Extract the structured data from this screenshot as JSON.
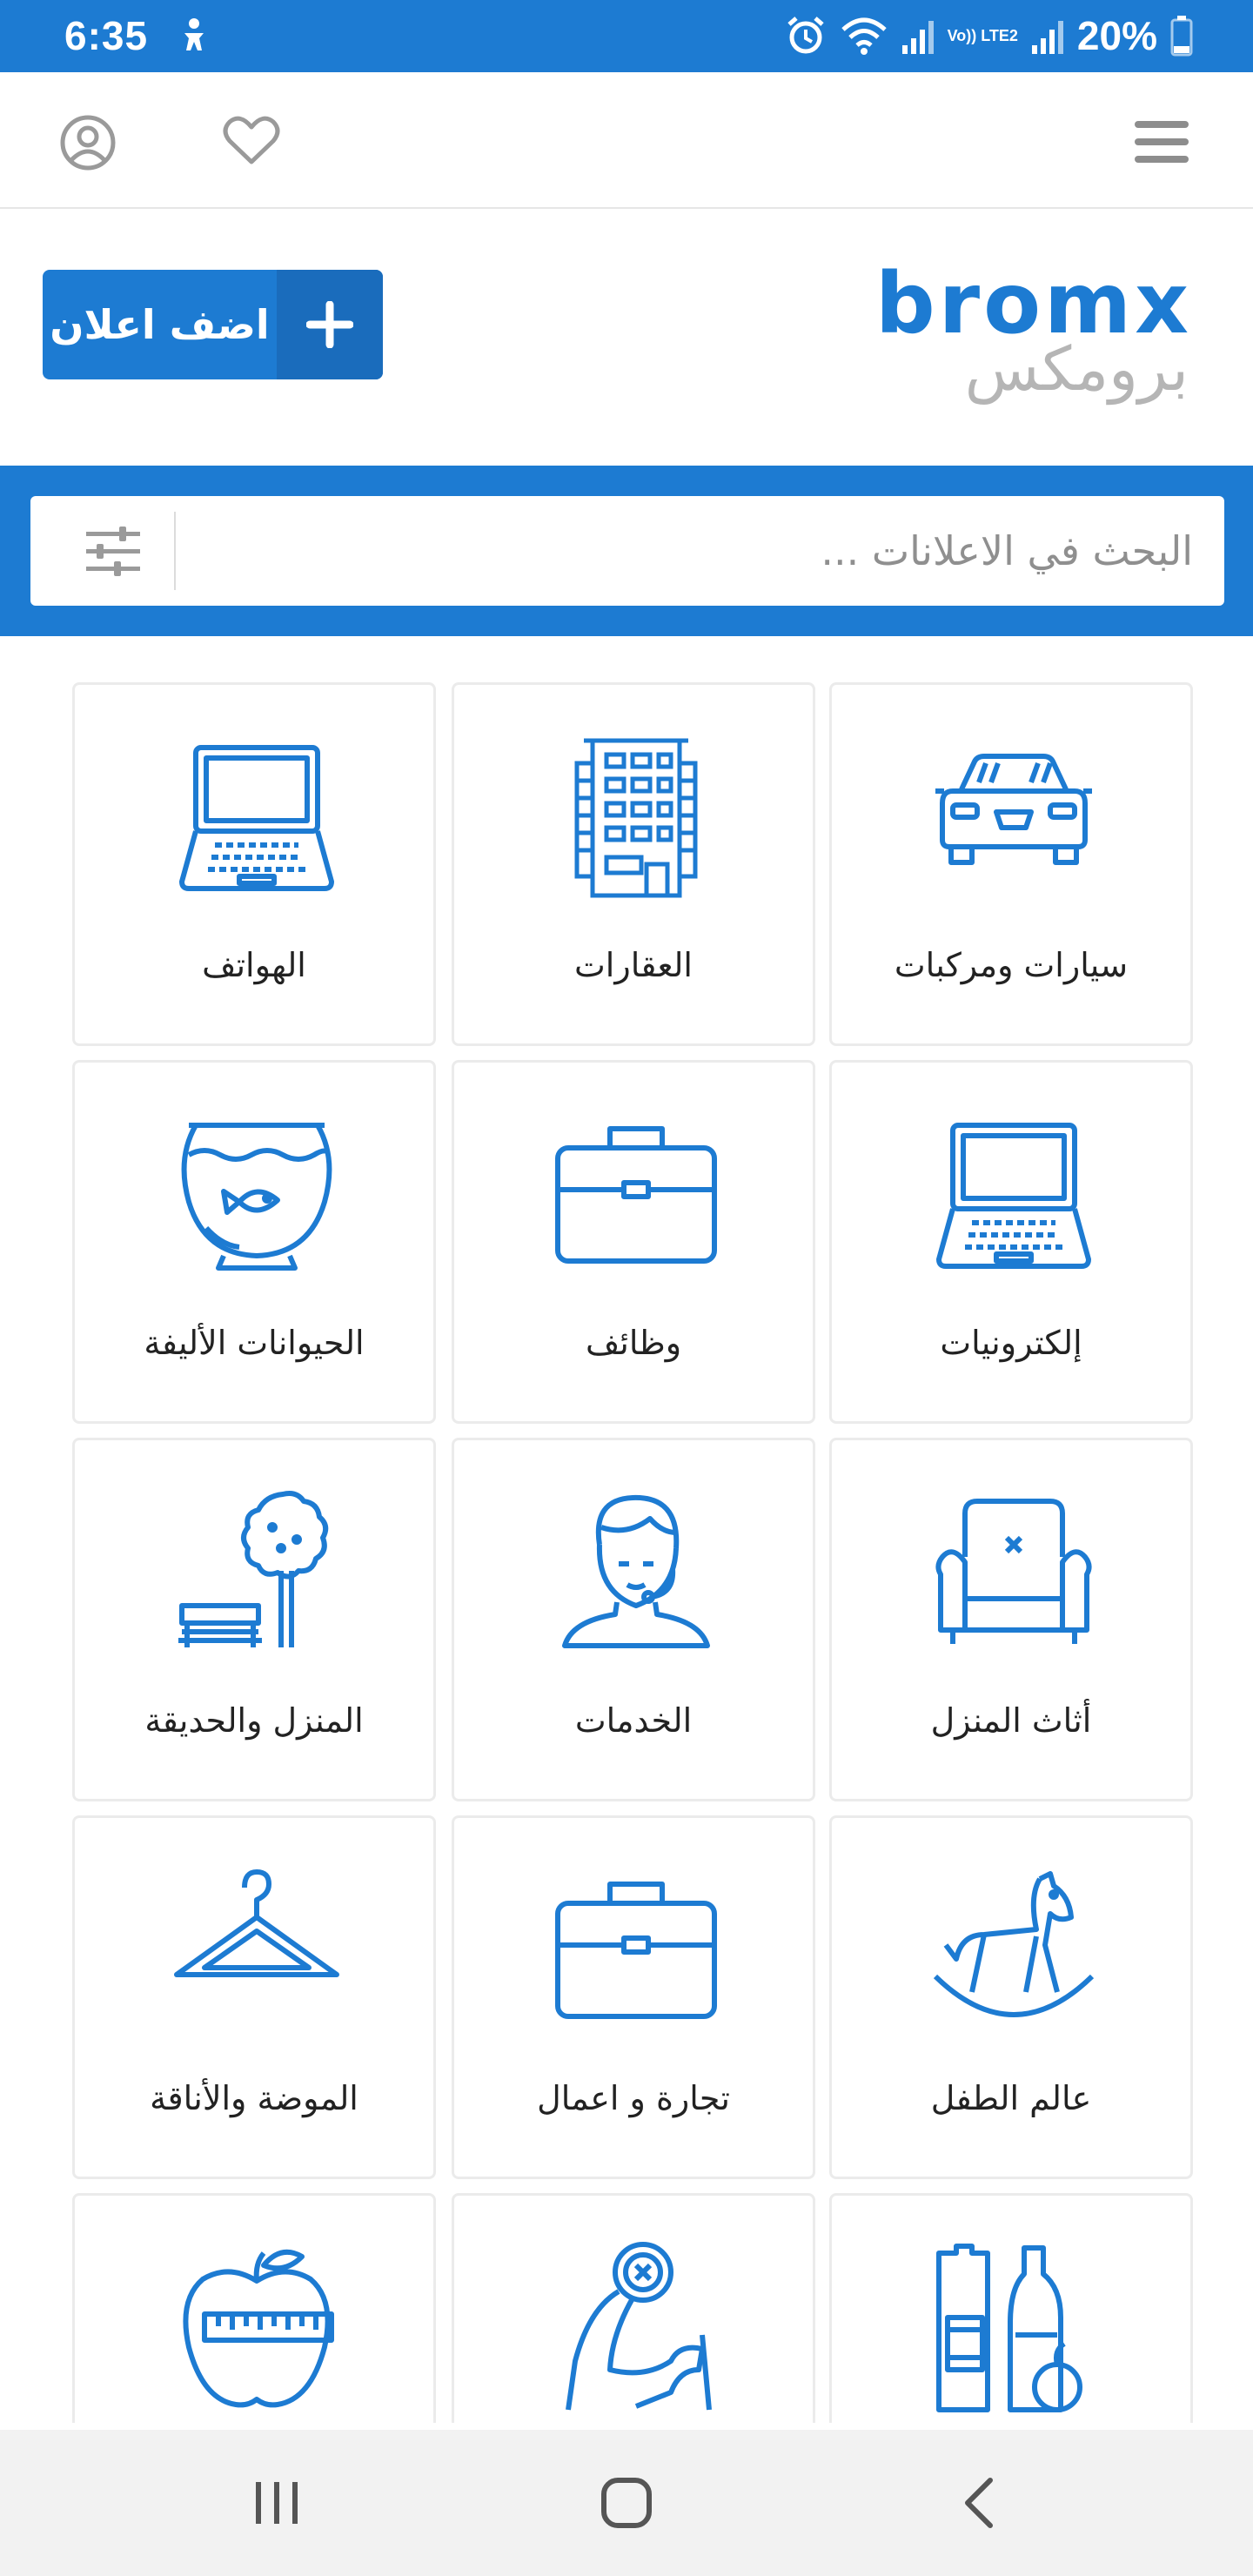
{
  "status": {
    "time": "6:35",
    "battery": "20%",
    "network_label": "Vo)) LTE2"
  },
  "header": {
    "menu": "menu-icon",
    "favorites": "heart-icon",
    "account": "user-circle-icon"
  },
  "brand": {
    "logo_latin": "bromx",
    "logo_arabic": "برومكس",
    "add_button_label": "اضف اعلان"
  },
  "search": {
    "placeholder": "البحث في الاعلانات ..."
  },
  "colors": {
    "primary": "#1d7bd2",
    "primary_dark": "#1a6cbc",
    "logo_gray": "#b5b5b5",
    "icon_blue": "#1d7bd2"
  },
  "categories": [
    {
      "label": "سيارات ومركبات",
      "icon": "car-icon"
    },
    {
      "label": "العقارات",
      "icon": "building-icon"
    },
    {
      "label": "الهواتف",
      "icon": "laptop-icon"
    },
    {
      "label": "إلكترونيات",
      "icon": "laptop-icon"
    },
    {
      "label": "وظائف",
      "icon": "briefcase-icon"
    },
    {
      "label": "الحيوانات الأليفة",
      "icon": "fishbowl-icon"
    },
    {
      "label": "أثاث المنزل",
      "icon": "armchair-icon"
    },
    {
      "label": "الخدمات",
      "icon": "support-agent-icon"
    },
    {
      "label": "المنزل والحديقة",
      "icon": "tree-bench-icon"
    },
    {
      "label": "عالم الطفل",
      "icon": "rocking-horse-icon"
    },
    {
      "label": "تجارة و اعمال",
      "icon": "briefcase-icon"
    },
    {
      "label": "الموضة والأناقة",
      "icon": "hanger-icon"
    },
    {
      "label": "",
      "icon": "groceries-icon"
    },
    {
      "label": "",
      "icon": "fitness-arm-icon"
    },
    {
      "label": "",
      "icon": "apple-measure-icon"
    }
  ],
  "system_nav": {
    "recents": "recents-icon",
    "home": "home-icon",
    "back": "back-icon"
  }
}
